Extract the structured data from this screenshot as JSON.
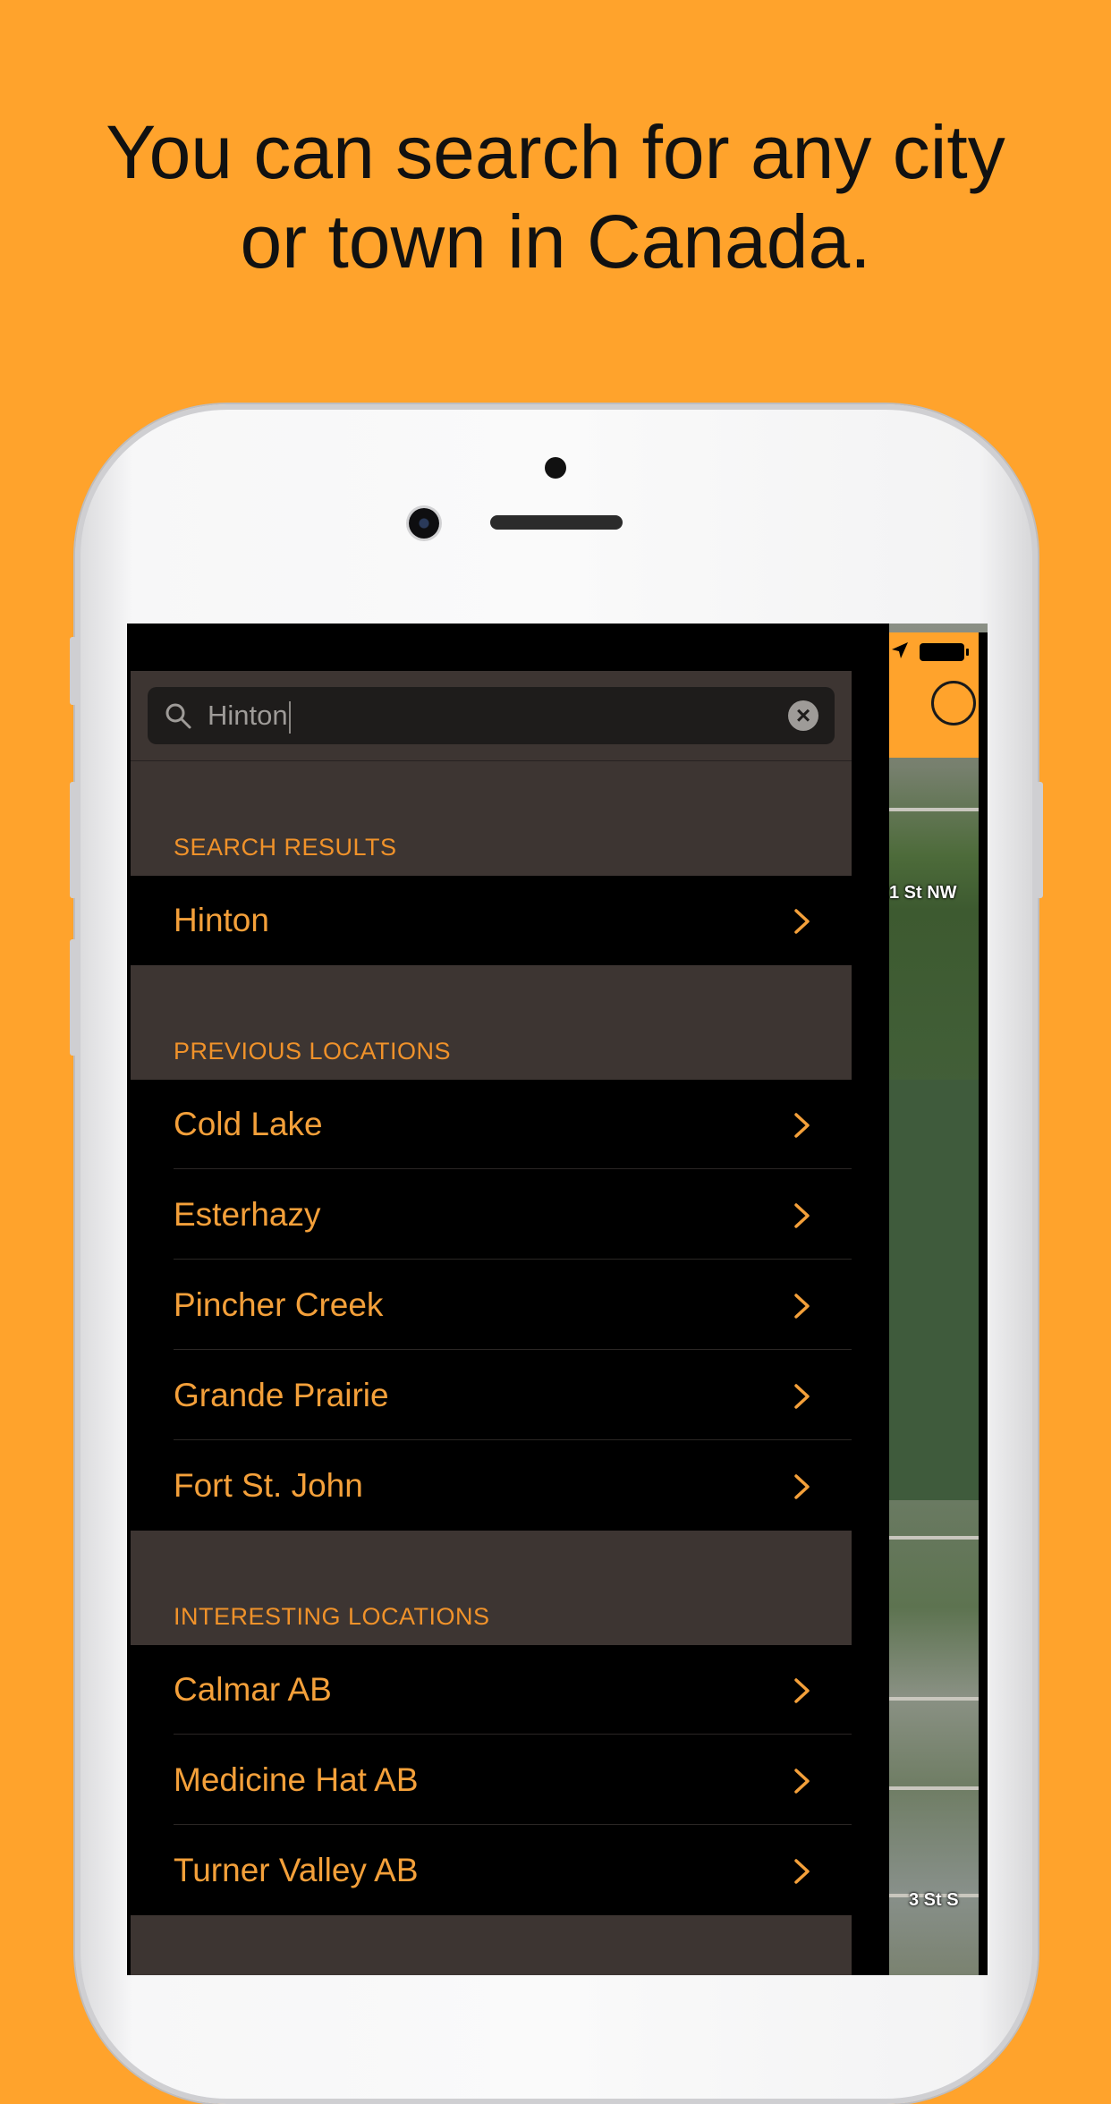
{
  "headline": {
    "line1": "You can search for any city",
    "line2": "or town in Canada."
  },
  "search": {
    "value": "Hinton",
    "clear_glyph": "×"
  },
  "sections": {
    "results_title": "SEARCH RESULTS",
    "results": [
      "Hinton"
    ],
    "previous_title": "PREVIOUS LOCATIONS",
    "previous": [
      "Cold Lake",
      "Esterhazy",
      "Pincher Creek",
      "Grande Prairie",
      "Fort St. John"
    ],
    "interesting_title": "INTERESTING LOCATIONS",
    "interesting": [
      "Calmar AB",
      "Medicine Hat AB",
      "Turner Valley AB"
    ]
  },
  "map": {
    "street_label_1": "1 St NW",
    "street_label_2": "3 St S"
  },
  "colors": {
    "background": "#FFA32C",
    "accent": "#F4A03A",
    "section_bg": "#3D3532"
  },
  "icons": {
    "search": "search-icon",
    "clear": "clear-icon",
    "chevron": "chevron-right-icon",
    "battery": "battery-icon",
    "location": "location-arrow-icon"
  }
}
